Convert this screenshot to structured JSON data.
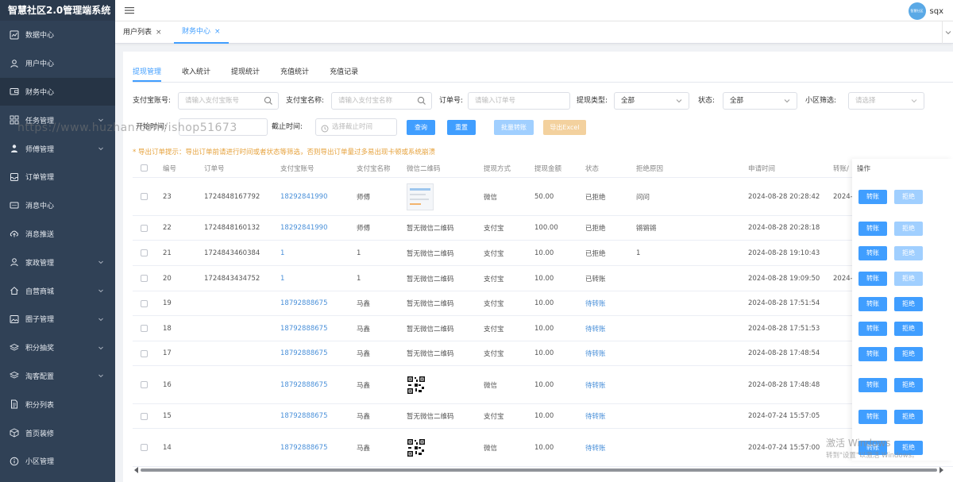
{
  "app": {
    "title": "智慧社区2.0管理端系统"
  },
  "user": {
    "avatar_text": "智慧社区",
    "name": "sqx"
  },
  "sidebar": {
    "items": [
      {
        "label": "数据中心",
        "icon": "chart-icon",
        "chevron": false
      },
      {
        "label": "用户中心",
        "icon": "user-icon",
        "chevron": false
      },
      {
        "label": "财务中心",
        "icon": "wallet-icon",
        "chevron": false,
        "active": true
      },
      {
        "label": "任务管理",
        "icon": "task-icon",
        "chevron": true
      },
      {
        "label": "师傅管理",
        "icon": "worker-icon",
        "chevron": true
      },
      {
        "label": "订单管理",
        "icon": "order-icon",
        "chevron": false
      },
      {
        "label": "消息中心",
        "icon": "message-icon",
        "chevron": false
      },
      {
        "label": "消息推送",
        "icon": "cloud-upload-icon",
        "chevron": false
      },
      {
        "label": "家政管理",
        "icon": "user-icon",
        "chevron": true
      },
      {
        "label": "自营商城",
        "icon": "home-icon",
        "chevron": true
      },
      {
        "label": "圈子管理",
        "icon": "image-icon",
        "chevron": true
      },
      {
        "label": "积分抽奖",
        "icon": "layers-icon",
        "chevron": true
      },
      {
        "label": "淘客配置",
        "icon": "layers-icon",
        "chevron": true
      },
      {
        "label": "积分列表",
        "icon": "document-icon",
        "chevron": false
      },
      {
        "label": "首页装修",
        "icon": "box-icon",
        "chevron": false
      },
      {
        "label": "小区管理",
        "icon": "info-icon",
        "chevron": false
      }
    ]
  },
  "tags": [
    {
      "label": "用户列表",
      "close": "×"
    },
    {
      "label": "财务中心",
      "close": "×"
    }
  ],
  "subtabs": [
    "提现管理",
    "收入统计",
    "提现统计",
    "充值统计",
    "充值记录"
  ],
  "filters": {
    "alipay_account": {
      "label": "支付宝账号:",
      "placeholder": "请输入支付宝账号"
    },
    "alipay_name": {
      "label": "支付宝名称:",
      "placeholder": "请输入支付宝名称"
    },
    "order_no": {
      "label": "订单号:",
      "placeholder": "请输入订单号"
    },
    "withdraw_type": {
      "label": "提现类型:",
      "value": "全部"
    },
    "status": {
      "label": "状态:",
      "value": "全部"
    },
    "community": {
      "label": "小区筛选:",
      "placeholder": "请选择"
    },
    "start_time": {
      "label": "开始时间:"
    },
    "end_time": {
      "label": "截止时间:",
      "placeholder": "选择截止时间"
    }
  },
  "buttons": {
    "search": "查询",
    "reset": "重置",
    "batch_transfer": "批量转账",
    "export_excel": "导出Excel"
  },
  "notice": "* 导出订单提示：导出订单前请进行时间或者状态等筛选，否则导出订单量过多易出现卡顿或系统崩溃",
  "table": {
    "columns": [
      "编号",
      "订单号",
      "支付宝账号",
      "支付宝名称",
      "微信二维码",
      "提现方式",
      "提现金额",
      "状态",
      "拒绝原因",
      "申请时间",
      "转账/",
      "操作"
    ],
    "actions": {
      "transfer": "转账",
      "reject": "拒绝"
    },
    "rows": [
      {
        "id": "23",
        "order": "1724848167792",
        "account": "18292841990",
        "name": "师傅",
        "qr": "image",
        "method": "微信",
        "amount": "50.00",
        "status": "已拒绝",
        "reason": "问问",
        "time": "2024-08-28 20:28:42",
        "transfer_time": "2024-",
        "reject_enabled": false
      },
      {
        "id": "22",
        "order": "1724848160132",
        "account": "18292841990",
        "name": "师傅",
        "qr": "暂无微信二维码",
        "method": "支付宝",
        "amount": "100.00",
        "status": "已拒绝",
        "reason": "锵锵锵",
        "time": "2024-08-28 20:28:18",
        "transfer_time": "",
        "reject_enabled": false
      },
      {
        "id": "21",
        "order": "1724843460384",
        "account": "1",
        "name": "1",
        "qr": "暂无微信二维码",
        "method": "支付宝",
        "amount": "10.00",
        "status": "已拒绝",
        "reason": "1",
        "time": "2024-08-28 19:10:43",
        "transfer_time": "",
        "reject_enabled": false
      },
      {
        "id": "20",
        "order": "1724843434752",
        "account": "1",
        "name": "1",
        "qr": "暂无微信二维码",
        "method": "支付宝",
        "amount": "10.00",
        "status": "已转账",
        "reason": "",
        "time": "2024-08-28 19:09:50",
        "transfer_time": "2024-",
        "reject_enabled": false
      },
      {
        "id": "19",
        "order": "",
        "account": "18792888675",
        "name": "马鑫",
        "qr": "暂无微信二维码",
        "method": "支付宝",
        "amount": "10.00",
        "status": "待转账",
        "reason": "",
        "time": "2024-08-28 17:51:54",
        "transfer_time": "",
        "reject_enabled": true
      },
      {
        "id": "18",
        "order": "",
        "account": "18792888675",
        "name": "马鑫",
        "qr": "暂无微信二维码",
        "method": "支付宝",
        "amount": "10.00",
        "status": "待转账",
        "reason": "",
        "time": "2024-08-28 17:51:53",
        "transfer_time": "",
        "reject_enabled": true
      },
      {
        "id": "17",
        "order": "",
        "account": "18792888675",
        "name": "马鑫",
        "qr": "暂无微信二维码",
        "method": "支付宝",
        "amount": "10.00",
        "status": "待转账",
        "reason": "",
        "time": "2024-08-28 17:48:54",
        "transfer_time": "",
        "reject_enabled": true
      },
      {
        "id": "16",
        "order": "",
        "account": "18792888675",
        "name": "马鑫",
        "qr": "qrcode",
        "method": "微信",
        "amount": "10.00",
        "status": "待转账",
        "reason": "",
        "time": "2024-08-28 17:48:48",
        "transfer_time": "",
        "reject_enabled": true
      },
      {
        "id": "15",
        "order": "",
        "account": "18792888675",
        "name": "马鑫",
        "qr": "暂无微信二维码",
        "method": "支付宝",
        "amount": "10.00",
        "status": "待转账",
        "reason": "",
        "time": "2024-07-24 15:57:05",
        "transfer_time": "",
        "reject_enabled": true
      },
      {
        "id": "14",
        "order": "",
        "account": "18792888675",
        "name": "马鑫",
        "qr": "qrcode",
        "method": "微信",
        "amount": "10.00",
        "status": "待转账",
        "reason": "",
        "time": "2024-07-24 15:57:00",
        "transfer_time": "",
        "reject_enabled": true
      }
    ]
  },
  "watermark": "https://www.huzhan.com/ishop51673",
  "windows": {
    "line1": "激活 Windows",
    "line2": "转到\"设置\"以激活 Windows。"
  },
  "colors": {
    "primary": "#409eff",
    "sidebar": "#304156",
    "warning": "#e6a23c",
    "disabled": "#a0cfff"
  }
}
